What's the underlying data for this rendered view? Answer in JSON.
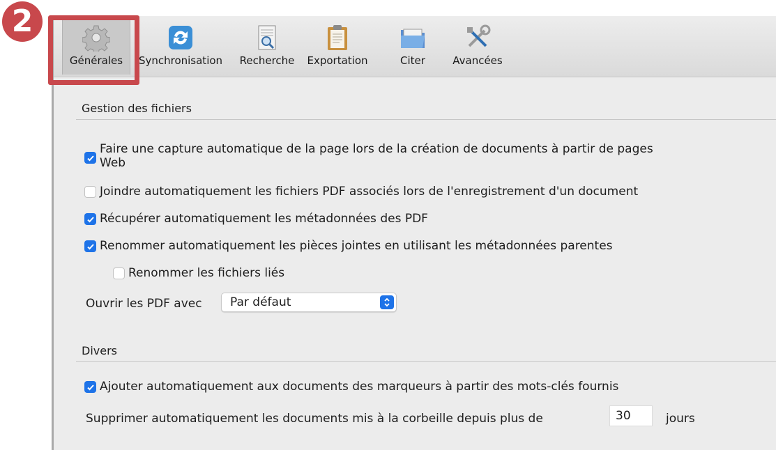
{
  "toolbar": {
    "items": [
      {
        "label": "Générales",
        "icon": "gear-icon"
      },
      {
        "label": "Synchronisation",
        "icon": "sync-icon"
      },
      {
        "label": "Recherche",
        "icon": "search-document-icon"
      },
      {
        "label": "Exportation",
        "icon": "clipboard-icon"
      },
      {
        "label": "Citer",
        "icon": "folder-icon"
      },
      {
        "label": "Avancées",
        "icon": "tools-icon"
      }
    ],
    "active_index": 0
  },
  "annotation": {
    "step_number": "2",
    "color": "#c8484c"
  },
  "file_management": {
    "title": "Gestion des fichiers",
    "snapshot": {
      "line1": "Faire une capture automatique de la page lors de la création de documents à partir de pages",
      "line2": "Web",
      "checked": true
    },
    "attach_pdfs": {
      "label": "Joindre automatiquement les fichiers PDF associés lors de l'enregistrement d'un document",
      "checked": false
    },
    "retrieve_metadata": {
      "label": "Récupérer automatiquement les métadonnées des PDF",
      "checked": true
    },
    "rename_attachments": {
      "label": "Renommer automatiquement les pièces jointes en utilisant les métadonnées parentes",
      "checked": true
    },
    "rename_linked": {
      "label": "Renommer les fichiers liés",
      "checked": false
    },
    "open_pdf": {
      "label": "Ouvrir les PDF avec",
      "value": "Par défaut"
    }
  },
  "misc": {
    "title": "Divers",
    "auto_tags": {
      "label": "Ajouter automatiquement aux documents des marqueurs à partir des mots-clés fournis",
      "checked": true
    },
    "trash": {
      "prefix": "Supprimer automatiquement les documents mis à la corbeille depuis plus de",
      "days": "30",
      "suffix": "jours"
    }
  },
  "colors": {
    "accent": "#1e73e8",
    "annotation": "#c8484c"
  }
}
